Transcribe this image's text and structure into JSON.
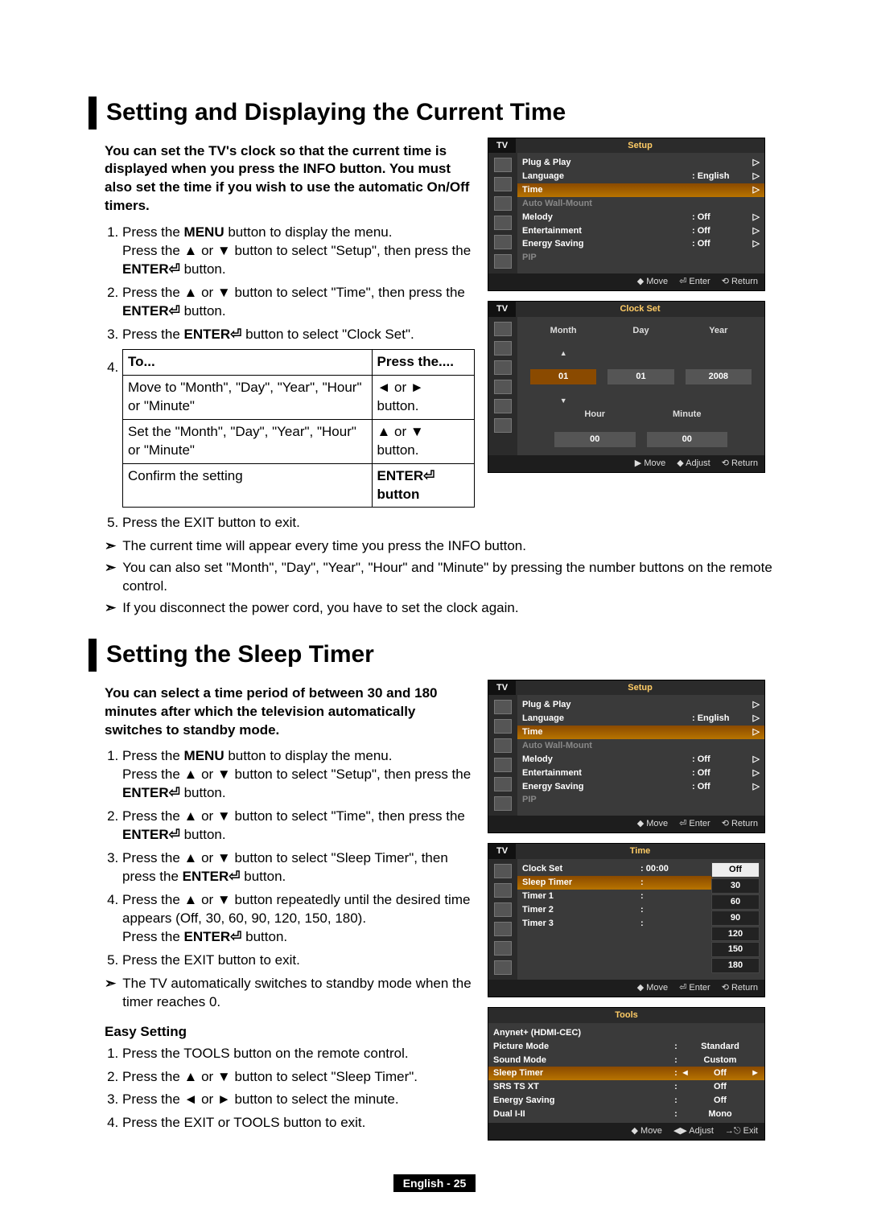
{
  "sections": {
    "time": {
      "title": "Setting and Displaying the Current Time",
      "intro": "You can set the TV's clock so that the current time is displayed when you press the INFO button. You must also set the time if you wish to use the automatic On/Off timers.",
      "table": {
        "head": [
          "To...",
          "Press the...."
        ],
        "rows": [
          [
            "Move to \"Month\", \"Day\", \"Year\", \"Hour\" or \"Minute\"",
            "◄ or ► button."
          ],
          [
            "Set the \"Month\", \"Day\", \"Year\", \"Hour\" or \"Minute\"",
            "▲ or ▼ button."
          ],
          [
            "Confirm the setting",
            "ENTER⏎ button"
          ]
        ]
      },
      "step5": "Press the EXIT button to exit.",
      "notes": [
        "The current time will appear every time you press the INFO button.",
        "You can also set \"Month\", \"Day\", \"Year\", \"Hour\" and \"Minute\" by pressing the number buttons on the remote control.",
        "If you disconnect the power cord, you have to set the clock again."
      ],
      "steps_html": {
        "s1a": "Press the ",
        "s1b": "MENU",
        "s1c": " button to display the menu.",
        "s1d": "Press the ▲ or ▼ button to select \"Setup\", then press the ",
        "s1e": "ENTER⏎",
        "s1f": " button.",
        "s2a": "Press the ▲ or ▼ button to select \"Time\", then press the ",
        "s2b": "ENTER⏎",
        "s2c": " button.",
        "s3a": "Press the ",
        "s3b": "ENTER⏎",
        "s3c": " button to select \"Clock Set\"."
      }
    },
    "sleep": {
      "title": "Setting the Sleep Timer",
      "intro": "You can select a time period of between 30 and 180 minutes after which the television automatically switches to standby mode.",
      "steps": {
        "s1a": "Press the ",
        "s1b": "MENU",
        "s1c": " button to display the menu.",
        "s1d": "Press the ▲ or ▼ button to select \"Setup\", then press the ",
        "s1e": "ENTER⏎",
        "s1f": " button.",
        "s2a": "Press the ▲ or ▼ button to select \"Time\", then press the ",
        "s2b": "ENTER⏎",
        "s2c": " button.",
        "s3a": "Press the ▲ or ▼ button to select \"Sleep Timer\", then press the ",
        "s3b": "ENTER⏎",
        "s3c": " button.",
        "s4a": "Press the ▲ or ▼ button repeatedly until the desired time appears (Off, 30, 60, 90, 120, 150, 180).",
        "s4b": "Press the ",
        "s4c": "ENTER⏎",
        "s4d": " button.",
        "s5": "Press the EXIT button to exit."
      },
      "note": "The TV automatically switches to standby mode when the timer reaches 0.",
      "easy": {
        "head": "Easy Setting",
        "s1": "Press the TOOLS button on the remote control.",
        "s2": "Press the ▲ or ▼ button to select \"Sleep Timer\".",
        "s3": "Press the ◄ or ► button to select the minute.",
        "s4": "Press the EXIT or TOOLS button to exit."
      }
    }
  },
  "osd": {
    "tv": "TV",
    "setup": {
      "title": "Setup",
      "items": [
        {
          "k": "Plug & Play",
          "v": "",
          "ch": "▷"
        },
        {
          "k": "Language",
          "v": ": English",
          "ch": "▷"
        },
        {
          "k": "Time",
          "v": "",
          "ch": "▷",
          "hi": true
        },
        {
          "k": "Auto Wall-Mount",
          "v": "",
          "ch": "",
          "dim": true
        },
        {
          "k": "Melody",
          "v": ": Off",
          "ch": "▷"
        },
        {
          "k": "Entertainment",
          "v": ": Off",
          "ch": "▷"
        },
        {
          "k": "Energy Saving",
          "v": ": Off",
          "ch": "▷"
        },
        {
          "k": "PIP",
          "v": "",
          "ch": "",
          "dim": true
        }
      ],
      "footer": [
        "◆ Move",
        "⏎ Enter",
        "⟲ Return"
      ]
    },
    "clockset": {
      "title": "Clock Set",
      "labels": [
        "Month",
        "Day",
        "Year",
        "Hour",
        "Minute"
      ],
      "vals": [
        "01",
        "01",
        "2008",
        "00",
        "00"
      ],
      "footer": [
        "▶ Move",
        "◆ Adjust",
        "⟲ Return"
      ]
    },
    "time": {
      "title": "Time",
      "items": [
        {
          "k": "Clock Set",
          "v": ": 00:00"
        },
        {
          "k": "Sleep Timer",
          "v": ":",
          "hi": true
        },
        {
          "k": "Timer 1",
          "v": ":"
        },
        {
          "k": "Timer 2",
          "v": ":"
        },
        {
          "k": "Timer 3",
          "v": ":"
        }
      ],
      "dropdown": [
        "Off",
        "30",
        "60",
        "90",
        "120",
        "150",
        "180"
      ],
      "footer": [
        "◆ Move",
        "⏎ Enter",
        "⟲ Return"
      ]
    },
    "tools": {
      "title": "Tools",
      "items": [
        {
          "k": "Anynet+ (HDMI-CEC)",
          "v": ""
        },
        {
          "k": "Picture Mode",
          "v": "Standard"
        },
        {
          "k": "Sound Mode",
          "v": "Custom"
        },
        {
          "k": "Sleep Timer",
          "v": "Off",
          "hi": true,
          "arrows": true
        },
        {
          "k": "SRS TS XT",
          "v": "Off"
        },
        {
          "k": "Energy Saving",
          "v": "Off"
        },
        {
          "k": "Dual I-II",
          "v": "Mono"
        }
      ],
      "footer": [
        "◆ Move",
        "◀▶ Adjust",
        "→⎋ Exit"
      ]
    }
  },
  "footer": "English - 25"
}
